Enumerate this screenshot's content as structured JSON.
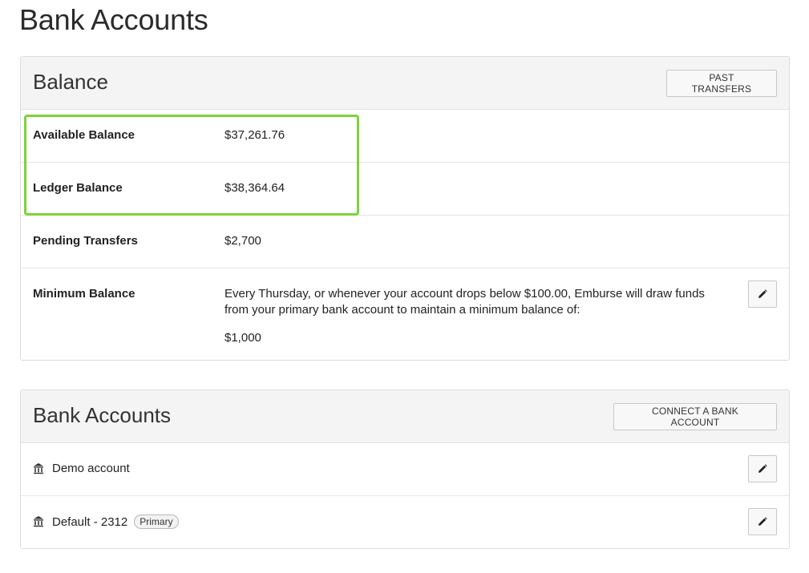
{
  "page": {
    "title": "Bank Accounts"
  },
  "balance_card": {
    "title": "Balance",
    "past_transfers_label": "PAST TRANSFERS",
    "rows": [
      {
        "label": "Available Balance",
        "value": "$37,261.76"
      },
      {
        "label": "Ledger Balance",
        "value": "$38,364.64"
      },
      {
        "label": "Pending Transfers",
        "value": "$2,700"
      }
    ],
    "minimum": {
      "label": "Minimum Balance",
      "description": "Every Thursday, or whenever your account drops below $100.00, Emburse will draw funds from your primary bank account to maintain a minimum balance of:",
      "amount": "$1,000",
      "edit_icon": "pencil-icon"
    },
    "highlight_color": "#7ed23a"
  },
  "accounts_card": {
    "title": "Bank Accounts",
    "connect_label": "CONNECT A BANK ACCOUNT",
    "accounts": [
      {
        "name": "Demo account",
        "icon": "bank-icon",
        "badge": ""
      },
      {
        "name": "Default - 2312",
        "icon": "bank-icon",
        "badge": "Primary"
      }
    ]
  }
}
